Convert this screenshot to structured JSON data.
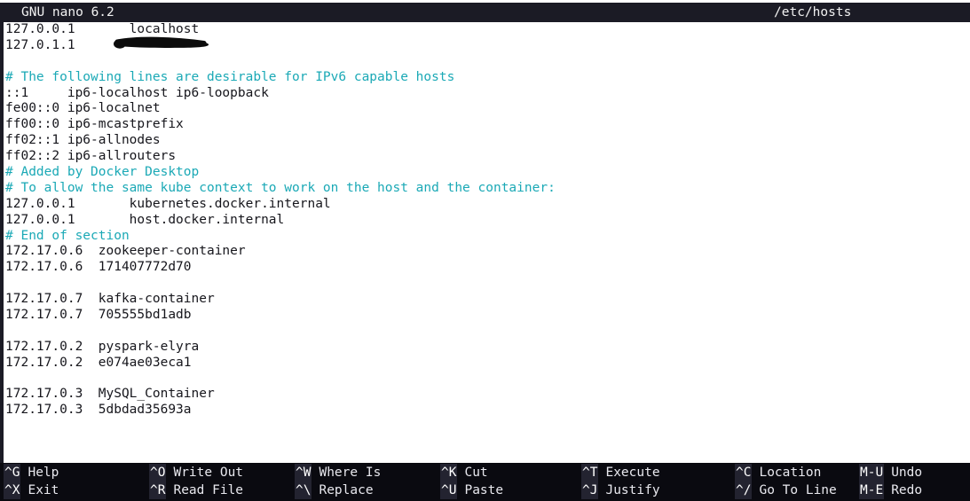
{
  "titlebar": {
    "version": "GNU nano 6.2",
    "filename": "/etc/hosts"
  },
  "editor": {
    "cursor_char": "1",
    "lines": [
      {
        "text": "127.0.0.1       localhost",
        "type": "text"
      },
      {
        "text": "127.0.1.1       ",
        "type": "text",
        "redacted": true
      },
      {
        "text": "",
        "type": "blank"
      },
      {
        "text": "# The following lines are desirable for IPv6 capable hosts",
        "type": "comment"
      },
      {
        "text": "::1     ip6-localhost ip6-loopback",
        "type": "text"
      },
      {
        "text": "fe00::0 ip6-localnet",
        "type": "text"
      },
      {
        "text": "ff00::0 ip6-mcastprefix",
        "type": "text"
      },
      {
        "text": "ff02::1 ip6-allnodes",
        "type": "text"
      },
      {
        "text": "ff02::2 ip6-allrouters",
        "type": "text"
      },
      {
        "text": "# Added by Docker Desktop",
        "type": "comment"
      },
      {
        "text": "# To allow the same kube context to work on the host and the container:",
        "type": "comment"
      },
      {
        "text": "127.0.0.1       kubernetes.docker.internal",
        "type": "text"
      },
      {
        "text": "127.0.0.1       host.docker.internal",
        "type": "text"
      },
      {
        "text": "# End of section",
        "type": "comment"
      },
      {
        "text": "172.17.0.6  zookeeper-container",
        "type": "text"
      },
      {
        "text": "172.17.0.6  171407772d70",
        "type": "text"
      },
      {
        "text": "",
        "type": "blank"
      },
      {
        "text": "172.17.0.7  kafka-container",
        "type": "text"
      },
      {
        "text": "172.17.0.7  705555bd1adb",
        "type": "text"
      },
      {
        "text": "",
        "type": "blank"
      },
      {
        "text": "172.17.0.2  pyspark-elyra",
        "type": "text"
      },
      {
        "text": "172.17.0.2  e074ae03eca1",
        "type": "text"
      },
      {
        "text": "",
        "type": "blank"
      },
      {
        "text": "172.17.0.3  MySQL_Container",
        "type": "text"
      },
      {
        "text": "172.17.0.3  5dbdad35693a",
        "type": "text"
      }
    ]
  },
  "shortcuts": [
    {
      "key": "^G",
      "label": "Help",
      "key2": "^X",
      "label2": "Exit"
    },
    {
      "key": "^O",
      "label": "Write Out",
      "key2": "^R",
      "label2": "Read File"
    },
    {
      "key": "^W",
      "label": "Where Is",
      "key2": "^\\",
      "label2": "Replace"
    },
    {
      "key": "^K",
      "label": "Cut",
      "key2": "^U",
      "label2": "Paste"
    },
    {
      "key": "^T",
      "label": "Execute",
      "key2": "^J",
      "label2": "Justify"
    },
    {
      "key": "^C",
      "label": "Location",
      "key2": "^/",
      "label2": "Go To Line"
    },
    {
      "key": "M-U",
      "label": "Undo",
      "key2": "M-E",
      "label2": "Redo"
    }
  ],
  "colors": {
    "titlebar_bg": "#1b1b25",
    "editor_bg": "#ffffff",
    "text_fg": "#16161c",
    "comment_fg": "#1ba9b6",
    "shortcutbar_bg": "#0a0a10",
    "key_bg": "#232330"
  }
}
